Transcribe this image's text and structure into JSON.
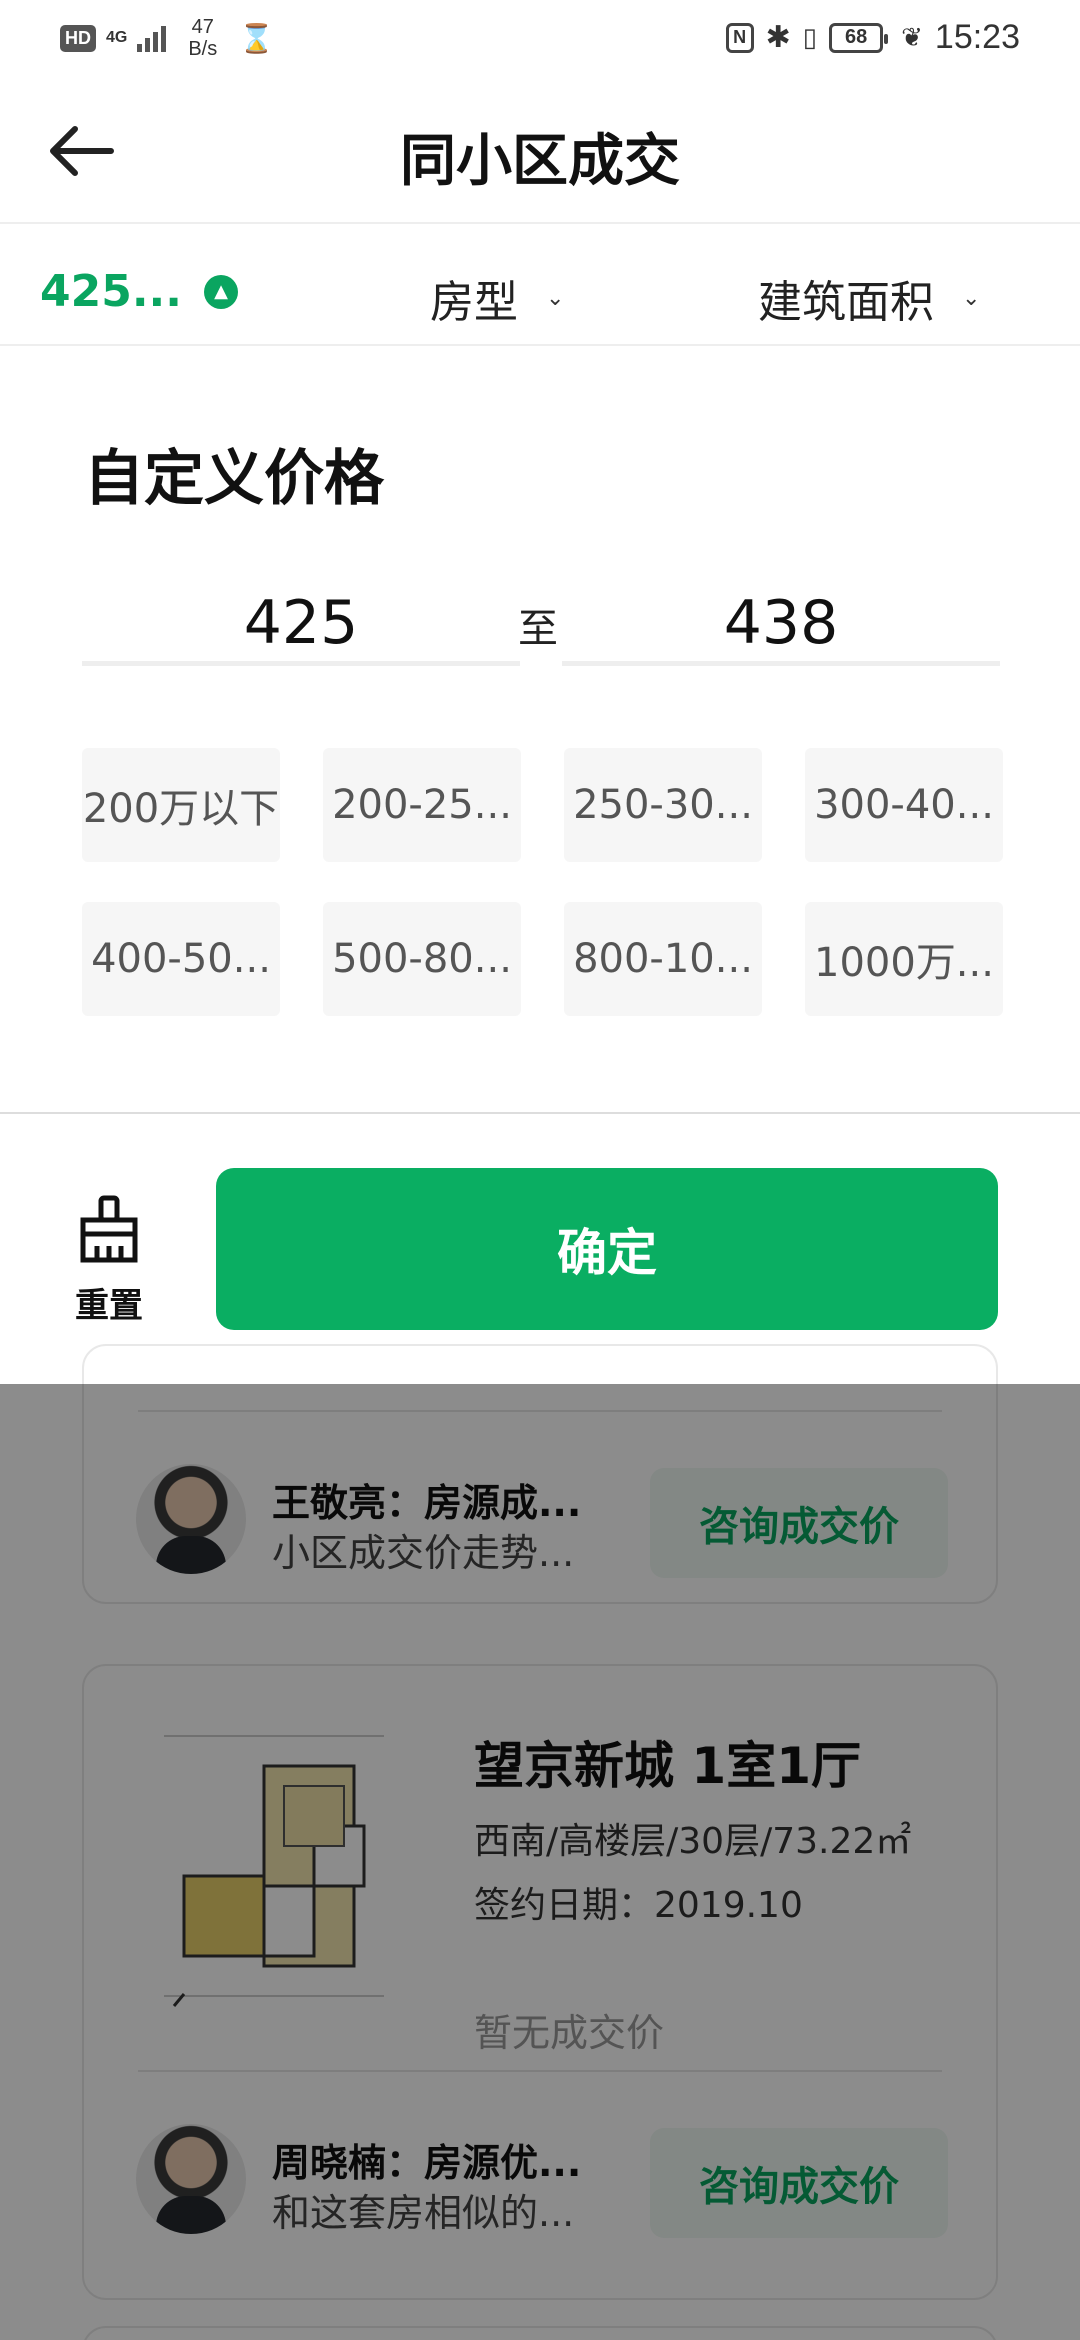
{
  "status_bar": {
    "hd": "HD",
    "network": "4G",
    "speed_value": "47",
    "speed_unit": "B/s",
    "nfc": "N",
    "battery": "68",
    "time": "15:23"
  },
  "header": {
    "title": "同小区成交"
  },
  "filters": {
    "price": "425...",
    "type": "房型",
    "area": "建筑面积"
  },
  "panel": {
    "title": "自定义价格",
    "min_value": "425",
    "separator": "至",
    "max_value": "438",
    "ranges": [
      "200万以下",
      "200-25...",
      "250-30...",
      "300-40...",
      "400-50...",
      "500-80...",
      "800-10...",
      "1000万..."
    ]
  },
  "actions": {
    "reset_label": "重置",
    "confirm_label": "确定"
  },
  "listings": {
    "card1": {
      "agent_name": "王敬亮：房源成...",
      "agent_desc": "小区成交价走势...",
      "consult": "咨询成交价"
    },
    "card2": {
      "title": "望京新城 1室1厅",
      "info": "西南/高楼层/30层/73.22㎡",
      "date": "签约日期：2019.10",
      "price": "暂无成交价",
      "agent_name": "周晓楠：房源优...",
      "agent_desc": "和这套房相似的...",
      "consult": "咨询成交价"
    }
  },
  "colors": {
    "accent": "#0aae62",
    "chip_bg": "#f6f6f6"
  }
}
